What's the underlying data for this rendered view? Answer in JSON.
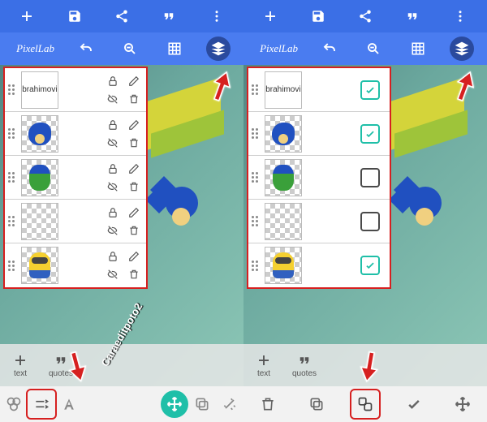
{
  "app": {
    "brand": "PixelLab"
  },
  "toolbars": {
    "primary": [
      {
        "name": "add-icon"
      },
      {
        "name": "save-icon"
      },
      {
        "name": "share-icon"
      },
      {
        "name": "quotes-icon"
      },
      {
        "name": "overflow-icon"
      }
    ],
    "secondary": [
      {
        "name": "undo-icon"
      },
      {
        "name": "zoom-icon"
      },
      {
        "name": "grid-icon"
      },
      {
        "name": "layers-icon"
      }
    ]
  },
  "layers": [
    {
      "kind": "text",
      "label": "Ibrahimovic",
      "checked": true
    },
    {
      "kind": "sonic",
      "label": "",
      "checked": true
    },
    {
      "kind": "green",
      "label": "",
      "checked": false
    },
    {
      "kind": "num",
      "label": "",
      "checked": false
    },
    {
      "kind": "minion",
      "label": "",
      "checked": true
    }
  ],
  "bottom_categories": {
    "text": "text",
    "quotes": "quotes"
  },
  "bottom_bar_left": {
    "items": [
      {
        "name": "palette-icon"
      },
      {
        "name": "size-adjust-icon",
        "highlight": true
      },
      {
        "name": "font-icon"
      }
    ],
    "fab": {
      "name": "move-icon"
    }
  },
  "bottom_bar_right": {
    "items": [
      {
        "name": "delete-icon"
      },
      {
        "name": "copy-icon"
      },
      {
        "name": "merge-icon",
        "highlight": true
      },
      {
        "name": "confirm-icon"
      },
      {
        "name": "move-icon"
      }
    ]
  },
  "watermark": "Caraeditpoto2",
  "colors": {
    "primary": "#3b6fe6",
    "secondary": "#4a7cf0",
    "accent": "#1fbfa8",
    "highlight": "#d62020"
  }
}
